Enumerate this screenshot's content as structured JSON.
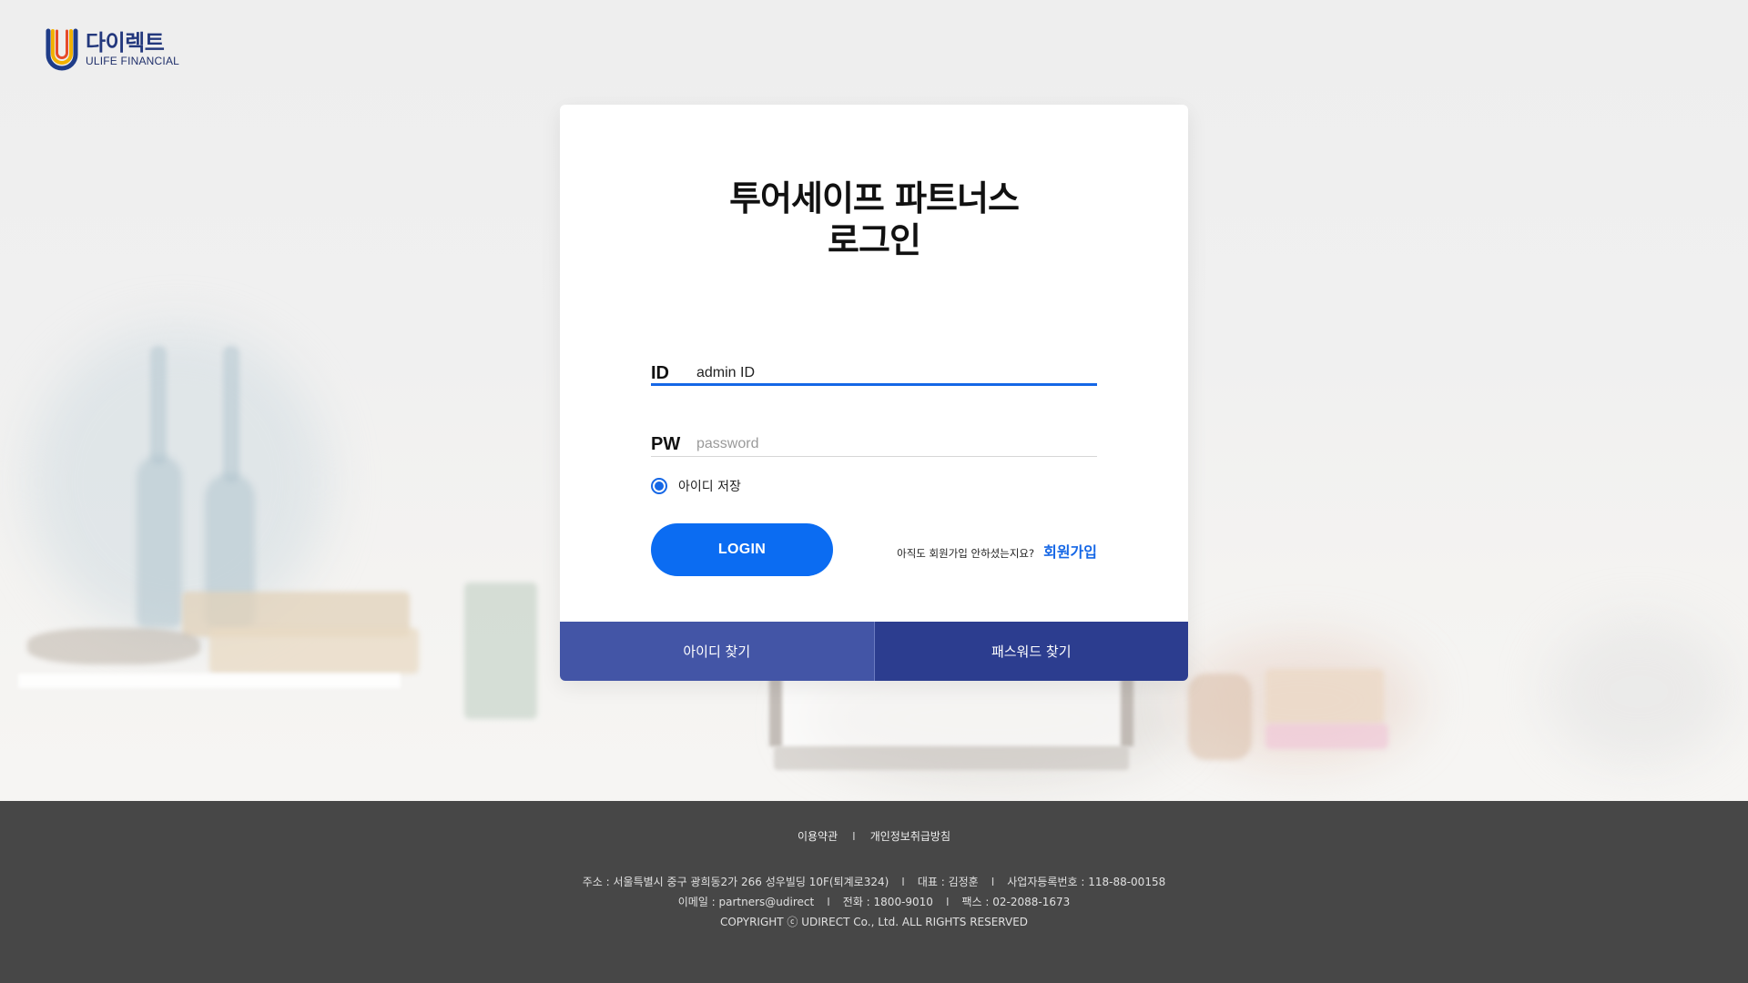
{
  "logo": {
    "brand_ko": "다이렉트",
    "brand_en": "ULIFE FINANCIAL"
  },
  "login": {
    "title_line1": "투어세이프 파트너스",
    "title_line2": "로그인",
    "id_label": "ID",
    "id_value": "admin ID",
    "pw_label": "PW",
    "pw_placeholder": "password",
    "remember_label": "아이디 저장",
    "remember_checked": true,
    "login_button": "LOGIN",
    "signup_question": "아직도 회원가입 안하셨는지요?",
    "signup_link": "회원가입",
    "find_id": "아이디 찾기",
    "find_pw": "패스워드 찾기"
  },
  "footer": {
    "link_terms": "이용약관",
    "link_privacy": "개인정보취급방침",
    "address": "주소 : 서울특별시 중구 광희동2가 266 성우빌딩 10F(퇴계로324)",
    "ceo": "대표 : 김정훈",
    "biz_no": "사업자등록번호 : 118-88-00158",
    "email": "이메일 : partners@udirect",
    "phone": "전화 : 1800-9010",
    "fax": "팩스 : 02-2088-1673",
    "copyright": "COPYRIGHT ⓒ UDIRECT Co., Ltd. ALL RIGHTS RESERVED",
    "separator": "I"
  },
  "colors": {
    "primary_blue": "#0b6cf2",
    "tab_left": "#4355a6",
    "tab_right": "#2c3d8f",
    "footer_bg": "#474747",
    "brand_navy": "#23387d"
  }
}
